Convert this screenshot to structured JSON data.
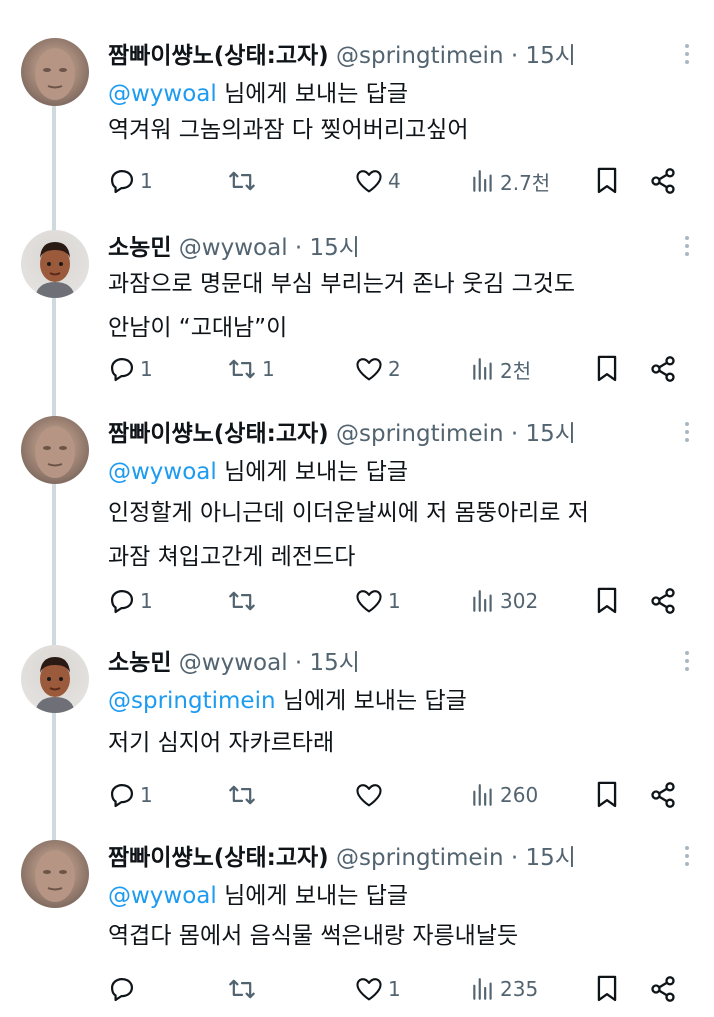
{
  "tweets": [
    {
      "name": "짬빠이썅노(상태:고자)",
      "handle": "@springtimein",
      "time": "15시",
      "reply_to": "@wywoal",
      "reply_suffix": "님에게 보내는 답글",
      "text_lines": [
        "역겨워 그놈의과잠 다 찢어버리고싶어"
      ],
      "replies": "1",
      "retweets": "",
      "likes": "4",
      "views": "2.7천"
    },
    {
      "name": "소농민",
      "handle": "@wywoal",
      "time": "15시",
      "text_lines": [
        "과잠으로 명문대 부심 부리는거 존나 웃김 그것도",
        "안남이 “고대남”이"
      ],
      "replies": "1",
      "retweets": "1",
      "likes": "2",
      "views": "2천"
    },
    {
      "name": "짬빠이썅노(상태:고자)",
      "handle": "@springtimein",
      "time": "15시",
      "reply_to": "@wywoal",
      "reply_suffix": "님에게 보내는 답글",
      "text_lines": [
        "인정할게 아니근데 이더운날씨에 저 몸뚱아리로 저",
        "과잠 쳐입고간게 레전드다"
      ],
      "replies": "1",
      "retweets": "",
      "likes": "1",
      "views": "302"
    },
    {
      "name": "소농민",
      "handle": "@wywoal",
      "time": "15시",
      "reply_to": "@springtimein",
      "reply_suffix": "님에게 보내는 답글",
      "text_lines": [
        "저기 심지어 자카르타래"
      ],
      "replies": "1",
      "retweets": "",
      "likes": "",
      "views": "260"
    },
    {
      "name": "짬빠이썅노(상태:고자)",
      "handle": "@springtimein",
      "time": "15시",
      "reply_to": "@wywoal",
      "reply_suffix": "님에게 보내는 답글",
      "text_lines": [
        "역겹다 몸에서 음식물 썩은내랑 자릉내날듯"
      ],
      "replies": "",
      "retweets": "",
      "likes": "1",
      "views": "235"
    }
  ],
  "icons": {
    "reply": "reply-icon",
    "retweet": "retweet-icon",
    "like": "heart-icon",
    "views": "views-icon",
    "bookmark": "bookmark-icon",
    "share": "share-icon",
    "more": "more-icon"
  },
  "colors": {
    "mention": "#1d9bf0",
    "secondary": "#536471",
    "thread_line": "#cfd9de"
  }
}
